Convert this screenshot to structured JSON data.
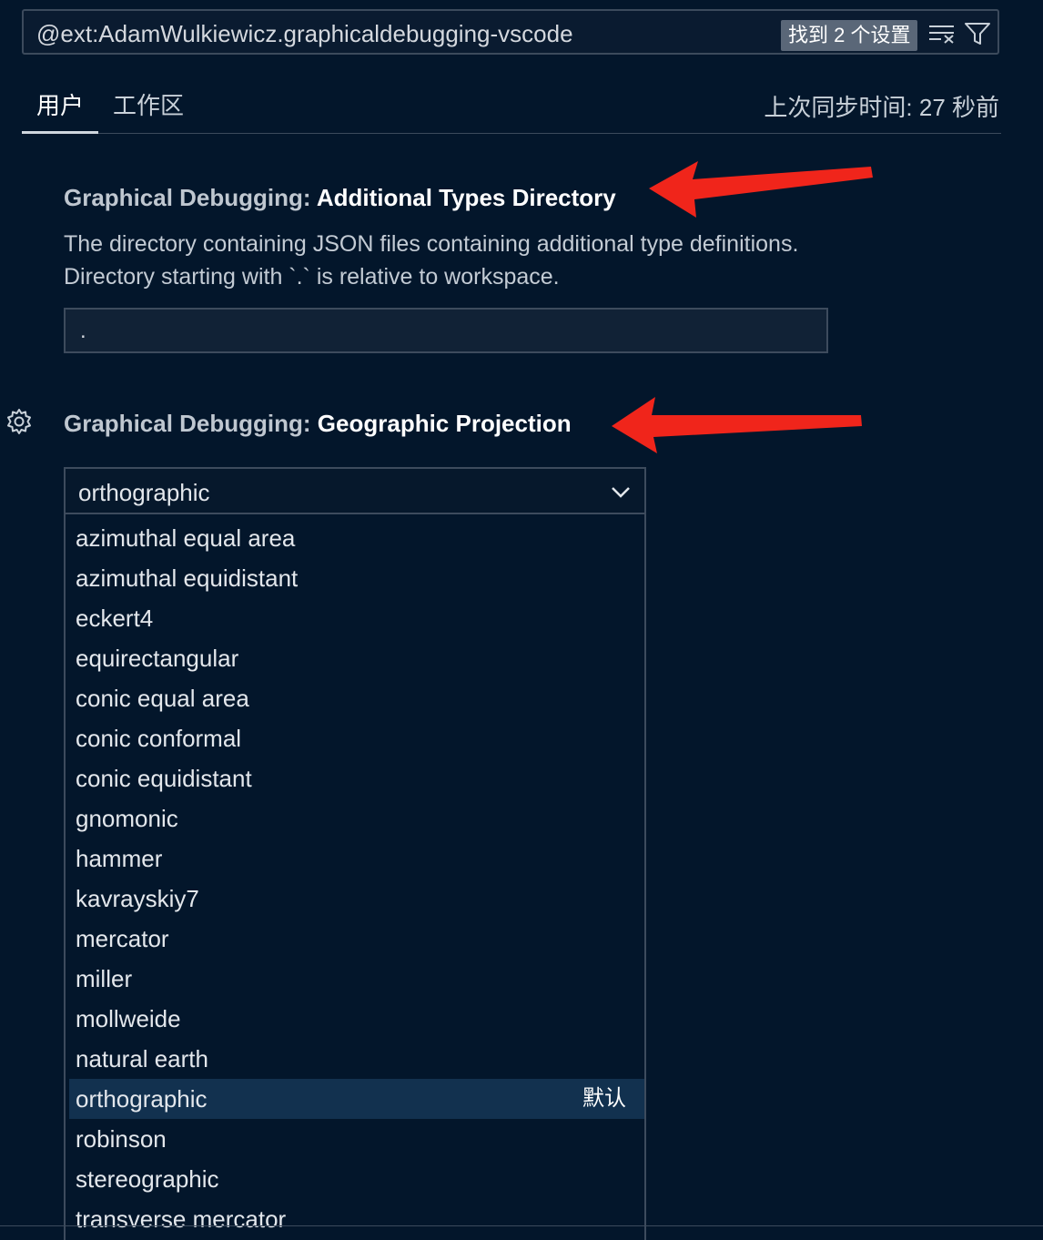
{
  "search": {
    "query": "@ext:AdamWulkiewicz.graphicaldebugging-vscode",
    "found_badge": "找到 2 个设置",
    "clear_icon": "clear-filter-icon",
    "filter_icon": "filter-icon"
  },
  "tabs": [
    {
      "label": "用户",
      "active": true
    },
    {
      "label": "工作区",
      "active": false
    }
  ],
  "sync_status": "上次同步时间: 27 秒前",
  "settings": [
    {
      "category": "Graphical Debugging: ",
      "name": "Additional Types Directory",
      "description_lines": [
        "The directory containing JSON files containing additional type definitions.",
        "Directory starting with `.` is relative to workspace."
      ],
      "value": "."
    },
    {
      "category": "Graphical Debugging: ",
      "name": "Geographic Projection",
      "value": "orthographic",
      "gear_icon": "gear-icon",
      "options": [
        {
          "label": "azimuthal equal area"
        },
        {
          "label": "azimuthal equidistant"
        },
        {
          "label": "eckert4"
        },
        {
          "label": "equirectangular"
        },
        {
          "label": "conic equal area"
        },
        {
          "label": "conic conformal"
        },
        {
          "label": "conic equidistant"
        },
        {
          "label": "gnomonic"
        },
        {
          "label": "hammer"
        },
        {
          "label": "kavrayskiy7"
        },
        {
          "label": "mercator"
        },
        {
          "label": "miller"
        },
        {
          "label": "mollweide"
        },
        {
          "label": "natural earth"
        },
        {
          "label": "orthographic",
          "selected": true,
          "tag": "默认"
        },
        {
          "label": "robinson"
        },
        {
          "label": "stereographic"
        },
        {
          "label": "transverse mercator"
        }
      ]
    }
  ],
  "colors": {
    "background": "#03162b",
    "annotation_arrow": "#f0251b",
    "selected_option": "#12314f"
  }
}
